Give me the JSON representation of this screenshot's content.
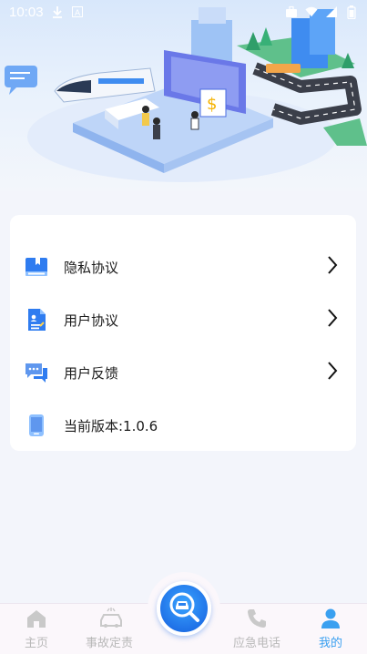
{
  "status_bar": {
    "time": "10:03"
  },
  "menu": {
    "items": [
      {
        "label": "隐私协议",
        "icon": "privacy-book-icon",
        "has_chevron": true
      },
      {
        "label": "用户协议",
        "icon": "user-agreement-doc-icon",
        "has_chevron": true
      },
      {
        "label": "用户反馈",
        "icon": "feedback-chat-icon",
        "has_chevron": true
      },
      {
        "label": "当前版本:1.0.6",
        "icon": "phone-version-icon",
        "has_chevron": false
      }
    ]
  },
  "tabbar": {
    "tabs": [
      {
        "label": "主页",
        "icon": "home-icon",
        "active": false
      },
      {
        "label": "事故定责",
        "icon": "car-accident-icon",
        "active": false
      },
      {
        "label": "应急电话",
        "icon": "phone-icon",
        "active": false
      },
      {
        "label": "我的",
        "icon": "person-icon",
        "active": true
      }
    ],
    "center_icon": "search-car-icon"
  },
  "colors": {
    "accent": "#3aa0f0",
    "icon_blue": "#2f7cf0",
    "inactive": "#b9b9b9",
    "background": "#f3f5fb"
  }
}
